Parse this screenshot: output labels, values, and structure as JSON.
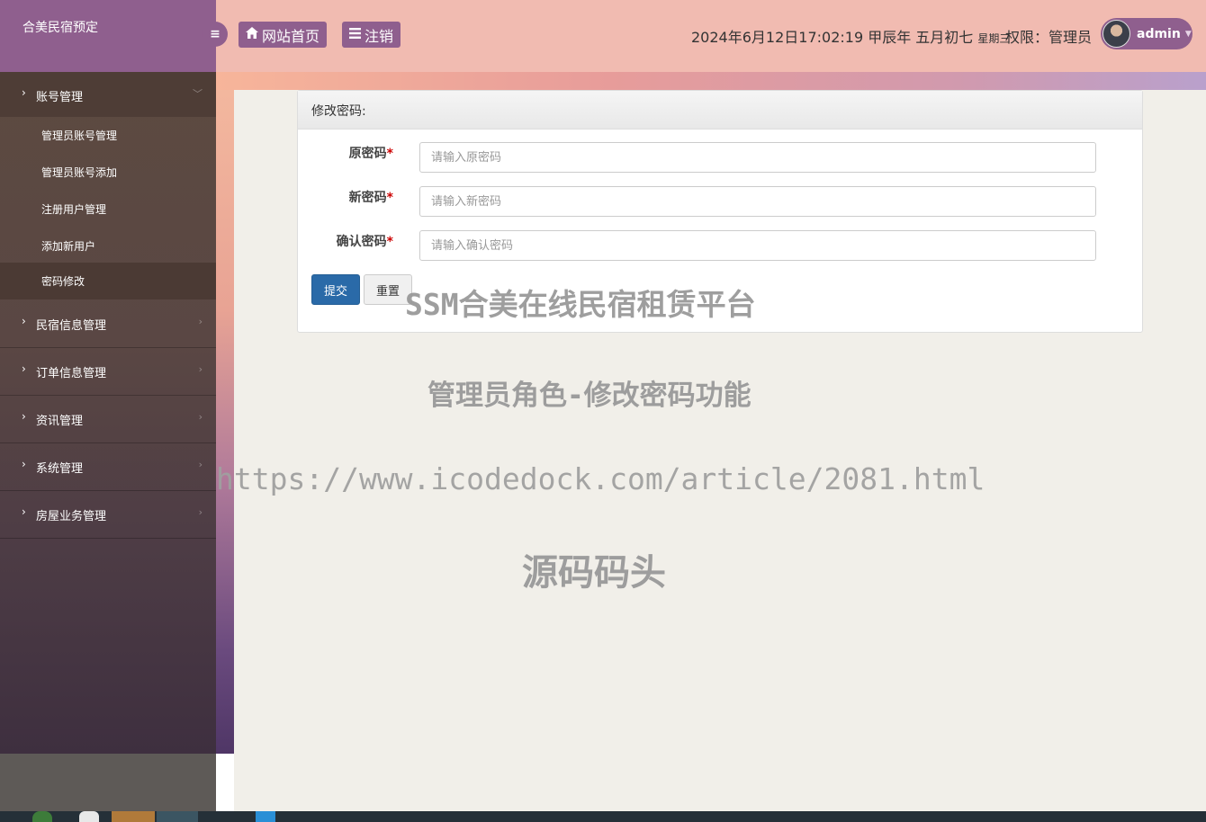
{
  "header": {
    "brand_title": "合美民宿预定",
    "toggle_icon": "≡",
    "home_button": "网站首页",
    "logout_button": "注销",
    "datetime": "2024年6月12日17:02:19 甲辰年 五月初七",
    "weekday": "星期三",
    "permission": "权限：管理员",
    "username": "admin"
  },
  "sidebar": {
    "groups": [
      {
        "label": "账号管理",
        "expanded": true,
        "items": [
          {
            "label": "管理员账号管理"
          },
          {
            "label": "管理员账号添加"
          },
          {
            "label": "注册用户管理"
          },
          {
            "label": "添加新用户"
          },
          {
            "label": "密码修改",
            "active": true
          }
        ]
      },
      {
        "label": "民宿信息管理"
      },
      {
        "label": "订单信息管理"
      },
      {
        "label": "资讯管理"
      },
      {
        "label": "系统管理"
      },
      {
        "label": "房屋业务管理"
      }
    ]
  },
  "form": {
    "title": "修改密码:",
    "fields": [
      {
        "label": "原密码",
        "required_mark": "*",
        "placeholder": "请输入原密码",
        "value": ""
      },
      {
        "label": "新密码",
        "required_mark": "*",
        "placeholder": "请输入新密码",
        "value": ""
      },
      {
        "label": "确认密码",
        "required_mark": "*",
        "placeholder": "请输入确认密码",
        "value": ""
      }
    ],
    "submit_label": "提交",
    "reset_label": "重置"
  },
  "watermarks": {
    "line1": "SSM合美在线民宿租赁平台",
    "line2": "管理员角色-修改密码功能",
    "line3": "https://www.icodedock.com/article/2081.html",
    "line4": "源码码头"
  },
  "colors": {
    "brand": "#8f5f8e",
    "header_bg": "#f1bbb1",
    "submit": "#2a6aa8",
    "required": "#cc0000"
  }
}
